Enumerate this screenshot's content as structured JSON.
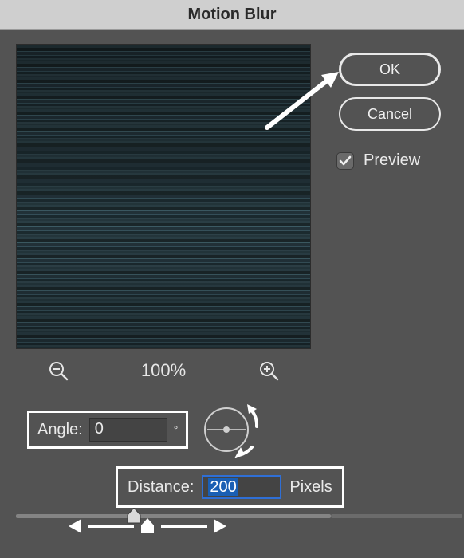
{
  "title": "Motion Blur",
  "buttons": {
    "ok": "OK",
    "cancel": "Cancel"
  },
  "preview": {
    "label": "Preview",
    "checked": true
  },
  "zoom": {
    "level": "100%"
  },
  "angle": {
    "label": "Angle:",
    "value": "0",
    "unit": "°"
  },
  "distance": {
    "label": "Distance:",
    "value": "200",
    "unit": "Pixels"
  }
}
